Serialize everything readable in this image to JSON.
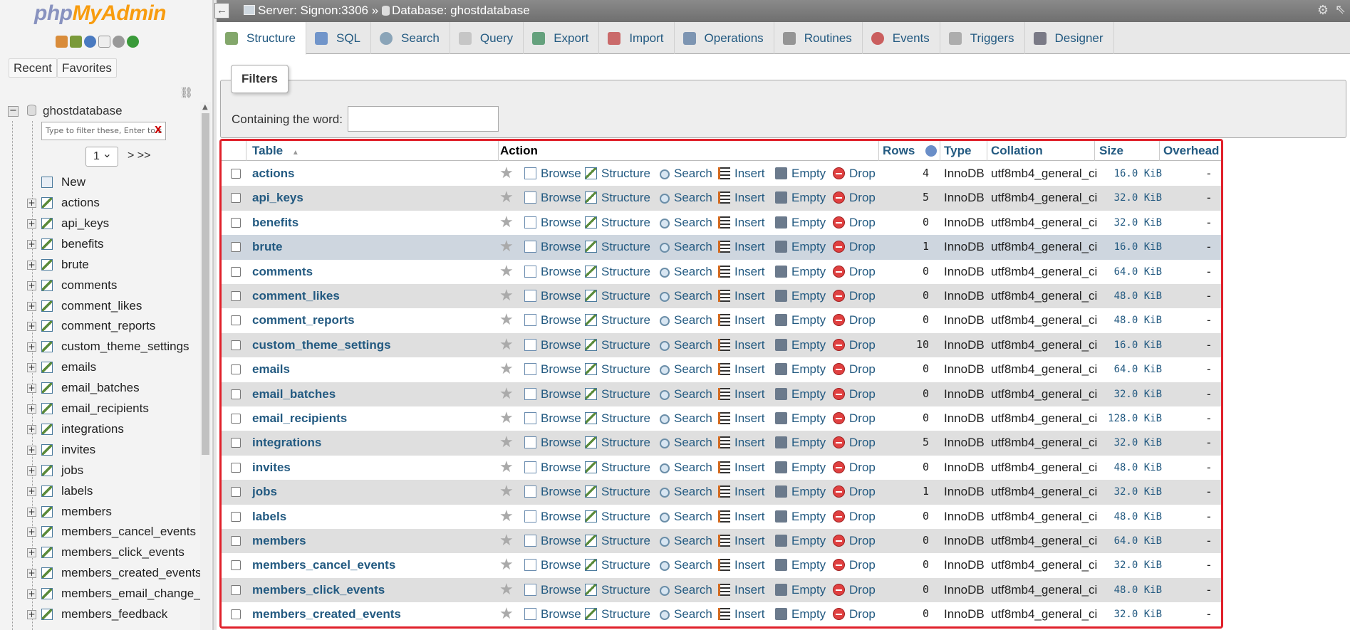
{
  "nav": {
    "logo_php": "php",
    "logo_myadmin": "MyAdmin",
    "recent_label": "Recent",
    "favorites_label": "Favorites",
    "db_name": "ghostdatabase",
    "filter_placeholder": "Type to filter these, Enter to s",
    "filter_clear": "X",
    "page_value": "1",
    "page_nav": "> >>",
    "new_label": "New",
    "tables": [
      "actions",
      "api_keys",
      "benefits",
      "brute",
      "comments",
      "comment_likes",
      "comment_reports",
      "custom_theme_settings",
      "emails",
      "email_batches",
      "email_recipients",
      "integrations",
      "invites",
      "jobs",
      "labels",
      "members",
      "members_cancel_events",
      "members_click_events",
      "members_created_events",
      "members_email_change_e",
      "members_feedback"
    ]
  },
  "topbar": {
    "back": "←",
    "server": "Server: Signon:3306",
    "sep": "»",
    "database": "Database: ghostdatabase"
  },
  "tabs": [
    "Structure",
    "SQL",
    "Search",
    "Query",
    "Export",
    "Import",
    "Operations",
    "Routines",
    "Events",
    "Triggers",
    "Designer"
  ],
  "filters": {
    "legend": "Filters",
    "label": "Containing the word:",
    "value": ""
  },
  "table": {
    "headers": {
      "table": "Table",
      "sort_indicator": "▲",
      "action": "Action",
      "rows": "Rows",
      "type": "Type",
      "collation": "Collation",
      "size": "Size",
      "overhead": "Overhead"
    },
    "actions": [
      "Browse",
      "Structure",
      "Search",
      "Insert",
      "Empty",
      "Drop"
    ],
    "rows": [
      {
        "name": "actions",
        "rows": "4",
        "type": "InnoDB",
        "collation": "utf8mb4_general_ci",
        "size": "16.0 KiB",
        "overhead": "-"
      },
      {
        "name": "api_keys",
        "rows": "5",
        "type": "InnoDB",
        "collation": "utf8mb4_general_ci",
        "size": "32.0 KiB",
        "overhead": "-"
      },
      {
        "name": "benefits",
        "rows": "0",
        "type": "InnoDB",
        "collation": "utf8mb4_general_ci",
        "size": "32.0 KiB",
        "overhead": "-"
      },
      {
        "name": "brute",
        "rows": "1",
        "type": "InnoDB",
        "collation": "utf8mb4_general_ci",
        "size": "16.0 KiB",
        "overhead": "-"
      },
      {
        "name": "comments",
        "rows": "0",
        "type": "InnoDB",
        "collation": "utf8mb4_general_ci",
        "size": "64.0 KiB",
        "overhead": "-"
      },
      {
        "name": "comment_likes",
        "rows": "0",
        "type": "InnoDB",
        "collation": "utf8mb4_general_ci",
        "size": "48.0 KiB",
        "overhead": "-"
      },
      {
        "name": "comment_reports",
        "rows": "0",
        "type": "InnoDB",
        "collation": "utf8mb4_general_ci",
        "size": "48.0 KiB",
        "overhead": "-"
      },
      {
        "name": "custom_theme_settings",
        "rows": "10",
        "type": "InnoDB",
        "collation": "utf8mb4_general_ci",
        "size": "16.0 KiB",
        "overhead": "-"
      },
      {
        "name": "emails",
        "rows": "0",
        "type": "InnoDB",
        "collation": "utf8mb4_general_ci",
        "size": "64.0 KiB",
        "overhead": "-"
      },
      {
        "name": "email_batches",
        "rows": "0",
        "type": "InnoDB",
        "collation": "utf8mb4_general_ci",
        "size": "32.0 KiB",
        "overhead": "-"
      },
      {
        "name": "email_recipients",
        "rows": "0",
        "type": "InnoDB",
        "collation": "utf8mb4_general_ci",
        "size": "128.0 KiB",
        "overhead": "-"
      },
      {
        "name": "integrations",
        "rows": "5",
        "type": "InnoDB",
        "collation": "utf8mb4_general_ci",
        "size": "32.0 KiB",
        "overhead": "-"
      },
      {
        "name": "invites",
        "rows": "0",
        "type": "InnoDB",
        "collation": "utf8mb4_general_ci",
        "size": "48.0 KiB",
        "overhead": "-"
      },
      {
        "name": "jobs",
        "rows": "1",
        "type": "InnoDB",
        "collation": "utf8mb4_general_ci",
        "size": "32.0 KiB",
        "overhead": "-"
      },
      {
        "name": "labels",
        "rows": "0",
        "type": "InnoDB",
        "collation": "utf8mb4_general_ci",
        "size": "48.0 KiB",
        "overhead": "-"
      },
      {
        "name": "members",
        "rows": "0",
        "type": "InnoDB",
        "collation": "utf8mb4_general_ci",
        "size": "64.0 KiB",
        "overhead": "-"
      },
      {
        "name": "members_cancel_events",
        "rows": "0",
        "type": "InnoDB",
        "collation": "utf8mb4_general_ci",
        "size": "32.0 KiB",
        "overhead": "-"
      },
      {
        "name": "members_click_events",
        "rows": "0",
        "type": "InnoDB",
        "collation": "utf8mb4_general_ci",
        "size": "48.0 KiB",
        "overhead": "-"
      },
      {
        "name": "members_created_events",
        "rows": "0",
        "type": "InnoDB",
        "collation": "utf8mb4_general_ci",
        "size": "32.0 KiB",
        "overhead": "-"
      }
    ]
  },
  "colors": {
    "link": "#235a81",
    "highlight_row": "#ced6df",
    "even_row": "#dfdfdf",
    "annotation_border": "#e0202a",
    "logo_php": "#8892bf",
    "logo_myadmin": "#f89c0e"
  }
}
